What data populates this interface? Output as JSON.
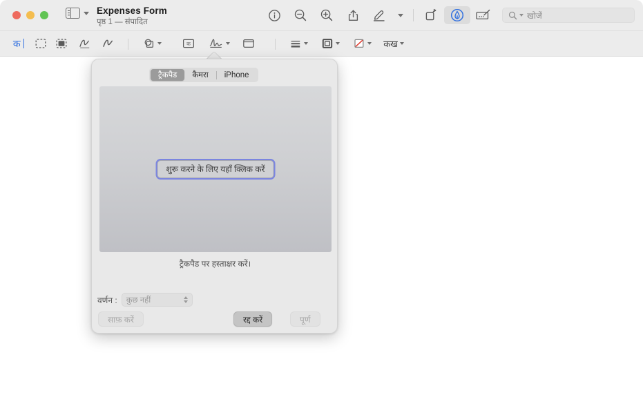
{
  "window": {
    "traffic_lights": [
      {
        "name": "close",
        "color": "#ee6a5e"
      },
      {
        "name": "minimize",
        "color": "#f4bd4f"
      },
      {
        "name": "zoom",
        "color": "#61c454"
      }
    ]
  },
  "titlebar": {
    "document_title": "Expenses Form",
    "document_subtitle": "पृष्ठ 1 — संपादित",
    "sidebar_icon": "sidebar-icon",
    "sidebar_chevron": "chevron-down-icon",
    "tools": [
      {
        "name": "info-icon",
        "label": "",
        "active": false
      },
      {
        "name": "zoom-out-icon",
        "label": "",
        "active": false
      },
      {
        "name": "zoom-in-icon",
        "label": "",
        "active": false
      },
      {
        "name": "share-icon",
        "label": "",
        "active": false
      },
      {
        "name": "highlight-pen-icon",
        "label": "",
        "active": false
      },
      {
        "name": "highlight-chevron-icon",
        "label": "",
        "active": false
      },
      {
        "name": "rotate-icon",
        "label": "",
        "active": false
      },
      {
        "name": "markup-icon",
        "label": "",
        "active": true
      },
      {
        "name": "form-fill-icon",
        "label": "",
        "active": false
      }
    ]
  },
  "search": {
    "placeholder": "खोजें",
    "value": "",
    "icon": "search-icon"
  },
  "markup_toolbar": {
    "items": [
      {
        "name": "text-selection-tool",
        "icon": "text-cursor-icon",
        "glyph": "क",
        "active": true
      },
      {
        "name": "rectangular-selection-tool",
        "icon": "dashed-rect-icon",
        "active": false
      },
      {
        "name": "instant-alpha-tool",
        "icon": "instant-alpha-icon",
        "active": false
      },
      {
        "name": "sketch-tool",
        "icon": "sketch-icon",
        "active": false
      },
      {
        "name": "draw-tool",
        "icon": "draw-icon",
        "active": false
      },
      {
        "name": "shapes-tool",
        "icon": "shapes-icon",
        "active": false
      },
      {
        "name": "text-box-tool",
        "icon": "text-box-icon",
        "active": false
      },
      {
        "name": "signature-tool",
        "icon": "signature-icon",
        "active": true
      },
      {
        "name": "note-tool",
        "icon": "note-icon",
        "active": false
      },
      {
        "name": "shape-style-tool",
        "icon": "shape-style-icon",
        "active": false
      },
      {
        "name": "border-style-tool",
        "icon": "border-style-icon",
        "active": false
      },
      {
        "name": "fill-color-tool",
        "icon": "fill-color-icon",
        "active": false
      },
      {
        "name": "text-style-tool",
        "icon": "text-style-icon",
        "glyph": "कख",
        "active": false
      }
    ]
  },
  "signature_popover": {
    "tabs": [
      {
        "label": "ट्रैकपैड",
        "selected": true
      },
      {
        "label": "कैमरा",
        "selected": false
      },
      {
        "label": "iPhone",
        "selected": false
      }
    ],
    "start_button_label": "शुरू करने के लिए यहाँ क्लिक करें",
    "hint_text": "ट्रैकपैड पर हस्ताक्षर करें।",
    "description_label": "वर्णन :",
    "description_value": "कुछ नहीं",
    "description_enabled": false,
    "buttons": {
      "clear": "साफ़ करें",
      "cancel": "रद्द करें",
      "done": "पूर्ण"
    }
  },
  "colors": {
    "accent_blue": "#2f6fe0",
    "focus_ring": "#7b85e0",
    "toolbar_bg": "#ececec",
    "popover_bg": "#e9e9e9"
  }
}
